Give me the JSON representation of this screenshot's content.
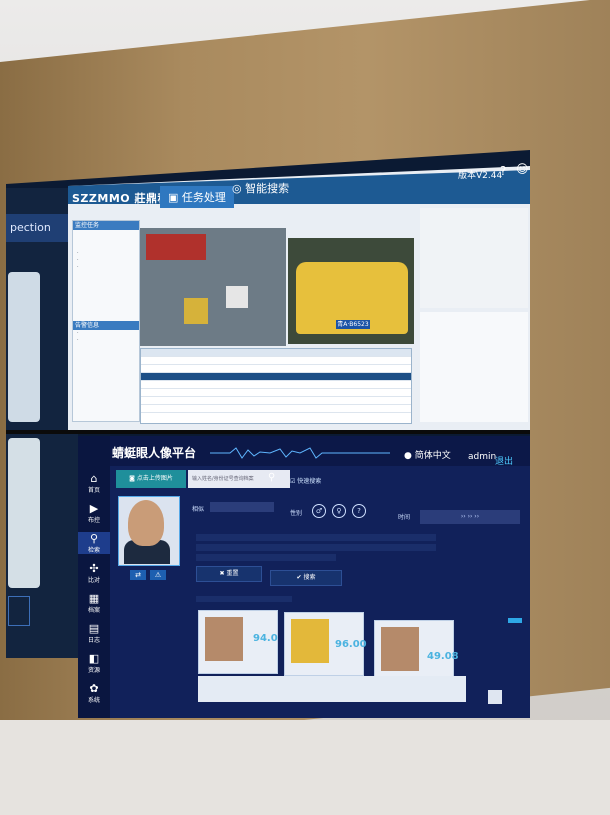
{
  "top_app": {
    "brand": "SZZMMO 莊鼎科技",
    "tabs": [
      "任务处理",
      "智能搜索"
    ],
    "version": "版本V2.44",
    "plate": "青A·B6523",
    "left_panel_title": "监控任务",
    "left_panel_title2": "告警信息"
  },
  "left_screen": {
    "tab": "pection"
  },
  "bottom_app": {
    "platform_title": "蜻蜓眼人像平台",
    "language": "简体中文",
    "user": "admin",
    "logout": "退出",
    "upload_button": "点击上传图片",
    "search_placeholder": "输入姓名/身份证号查询档案",
    "fast_search": "快速搜索",
    "similarity_label": "相似",
    "gender_label": "性别",
    "time_label": "时间",
    "reset_button": "✖ 重置",
    "search_button": "✔ 搜索",
    "sidebar": [
      {
        "icon": "⌂",
        "label": "首页"
      },
      {
        "icon": "▶",
        "label": "布控"
      },
      {
        "icon": "⚲",
        "label": "检索"
      },
      {
        "icon": "✣",
        "label": "比对"
      },
      {
        "icon": "▦",
        "label": "档案"
      },
      {
        "icon": "▤",
        "label": "日志"
      },
      {
        "icon": "◧",
        "label": "资源"
      },
      {
        "icon": "✿",
        "label": "系统"
      }
    ],
    "results": [
      {
        "score": "94.0"
      },
      {
        "score": "96.00"
      },
      {
        "score": "49.08"
      }
    ]
  }
}
